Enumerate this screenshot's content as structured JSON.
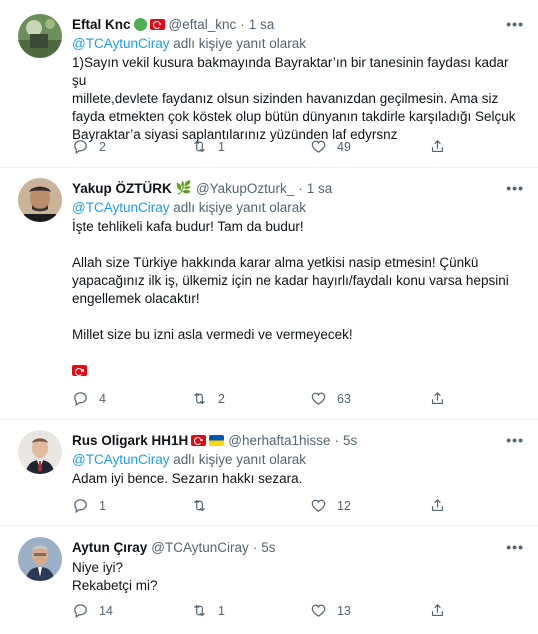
{
  "tweets": [
    {
      "name": "Eftal Knc",
      "handle": "@eftal_knc",
      "time": "1 sa",
      "reply_prefix": "@TCAytunCiray",
      "reply_suffix": " adlı kişiye yanıt olarak",
      "lines": [
        "1)Sayın vekil kusura bakmayında Bayraktar’ın bir tanesinin faydası kadar şu",
        "millete,devlete faydanız olsun sizinden havanızdan geçilmesin. Ama siz",
        "fayda etmekten çok köstek olup bütün dünyanın takdirle karşıladığı Selçuk",
        "Bayraktar’a siyasi saplantılarınız yüzünden laf edyrsnz"
      ],
      "replies": "2",
      "retweets": "1",
      "likes": "49"
    },
    {
      "name": "Yakup ÖZTÜRK",
      "handle": "@YakupOzturk_",
      "time": "1 sa",
      "reply_prefix": "@TCAytunCiray",
      "reply_suffix": " adlı kişiye yanıt olarak",
      "lines": [
        "İşte tehlikeli kafa budur! Tam da budur!",
        "",
        "Allah size Türkiye hakkında karar alma yetkisi nasip etmesin! Çünkü",
        "yapacağınız ilk iş, ülkemiz için ne kadar hayırlı/faydalı konu varsa hepsini",
        "engellemek olacaktır!",
        "",
        "Millet size bu izni asla vermedi ve vermeyecek!"
      ],
      "replies": "4",
      "retweets": "2",
      "likes": "63"
    },
    {
      "name": "Rus Oligark HH1H",
      "handle": "@herhafta1hisse",
      "time": "5s",
      "reply_prefix": "@TCAytunCiray",
      "reply_suffix": " adlı kişiye yanıt olarak",
      "lines": [
        "Adam iyi bence. Sezarın hakkı sezara."
      ],
      "replies": "1",
      "retweets": "",
      "likes": "12"
    },
    {
      "name": "Aytun Çıray",
      "handle": "@TCAytunCiray",
      "time": "5s",
      "lines": [
        "Niye iyi?",
        "Rekabetçi mi?"
      ],
      "replies": "14",
      "retweets": "1",
      "likes": "13"
    }
  ],
  "separator": "·",
  "more": "•••"
}
